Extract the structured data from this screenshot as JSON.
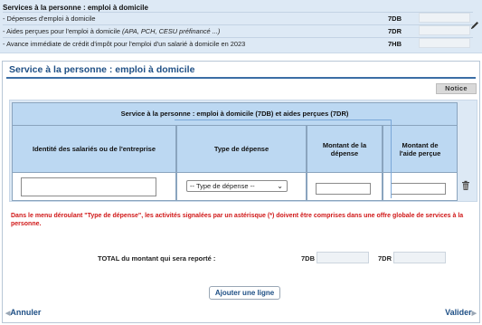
{
  "summary": {
    "title": "Services à la personne : emploi à domicile",
    "rows": [
      {
        "label": "- Dépenses d'emploi à domicile",
        "label_italic": "",
        "label_tail": "",
        "code": "7DB"
      },
      {
        "label": "- Aides perçues pour l'emploi à domicile ",
        "label_italic": "(APA, PCH, CESU préfinancé ...)",
        "label_tail": "",
        "code": "7DR"
      },
      {
        "label": "- Avance immédiate de crédit d'impôt pour l'emploi d'un salarié à domicile en 2023",
        "label_italic": "",
        "label_tail": "",
        "code": "7HB"
      }
    ]
  },
  "modal": {
    "title": "Service à la personne : emploi à domicile",
    "notice_label": "Notice",
    "table": {
      "caption": "Service à la personne : emploi à domicile (7DB) et aides perçues (7DR)",
      "columns": [
        "Identité des salariés ou de l'entreprise",
        "Type de dépense",
        "Montant de la dépense",
        "Montant de l'aide perçue"
      ],
      "row": {
        "identity": "",
        "type_selected": "-- Type de dépense --",
        "montant_depense": "",
        "montant_aide": ""
      }
    },
    "warning": "Dans le menu déroulant \"Type de dépense\", les activités signalées par un astérisque (*) doivent être comprises dans une offre globale de services à la personne.",
    "total": {
      "label": "TOTAL du montant qui sera reporté :",
      "code_a": "7DB",
      "code_b": "7DR",
      "value_a": "",
      "value_b": ""
    },
    "add_line_label": "Ajouter une ligne",
    "cancel_label": "Annuler",
    "validate_label": "Valider"
  },
  "icons": {
    "edit": "pencil-icon",
    "delete": "trash-icon",
    "select": "chevron-down-icon"
  },
  "colors": {
    "accent": "#1e4f85",
    "header_bg": "#bcd8f2",
    "panel_bg": "#dde9f5",
    "warning": "#d01818"
  }
}
